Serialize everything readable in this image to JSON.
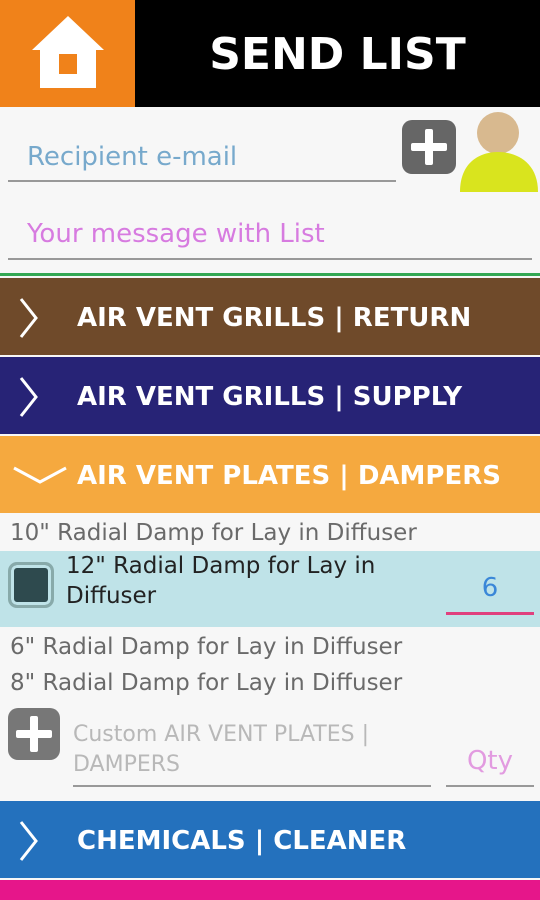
{
  "header": {
    "title": "SEND LIST",
    "home_icon": "home-icon"
  },
  "form": {
    "email_placeholder": "Recipient e-mail",
    "message_placeholder": "Your message with List",
    "add_contact_icon": "plus-icon",
    "avatar_icon": "person-icon"
  },
  "categories": [
    {
      "label": "AIR VENT GRILLS | RETURN",
      "color": "#6f4a2a",
      "expanded": false
    },
    {
      "label": "AIR VENT GRILLS | SUPPLY",
      "color": "#272376",
      "expanded": false
    },
    {
      "label": "AIR VENT PLATES | DAMPERS",
      "color": "#f5a93f",
      "expanded": true
    },
    {
      "label": "CHEMICALS | CLEANER",
      "color": "#2471bd",
      "expanded": false
    }
  ],
  "items": [
    {
      "label": "10\" Radial Damp for Lay in Diffuser"
    },
    {
      "label_line1": "12\" Radial Damp for Lay in",
      "label_line2": "Diffuser",
      "selected": true,
      "qty": "6"
    },
    {
      "label": "6\" Radial Damp for Lay in Diffuser"
    },
    {
      "label": "8\" Radial Damp for Lay in Diffuser"
    }
  ],
  "custom": {
    "placeholder_line1": "Custom AIR VENT PLATES |",
    "placeholder_line2": "DAMPERS",
    "qty_placeholder": "Qty"
  },
  "colors": {
    "home": "#f0821a",
    "selected_row": "#bfe3e8",
    "next_category_strip": "#e6168a"
  }
}
